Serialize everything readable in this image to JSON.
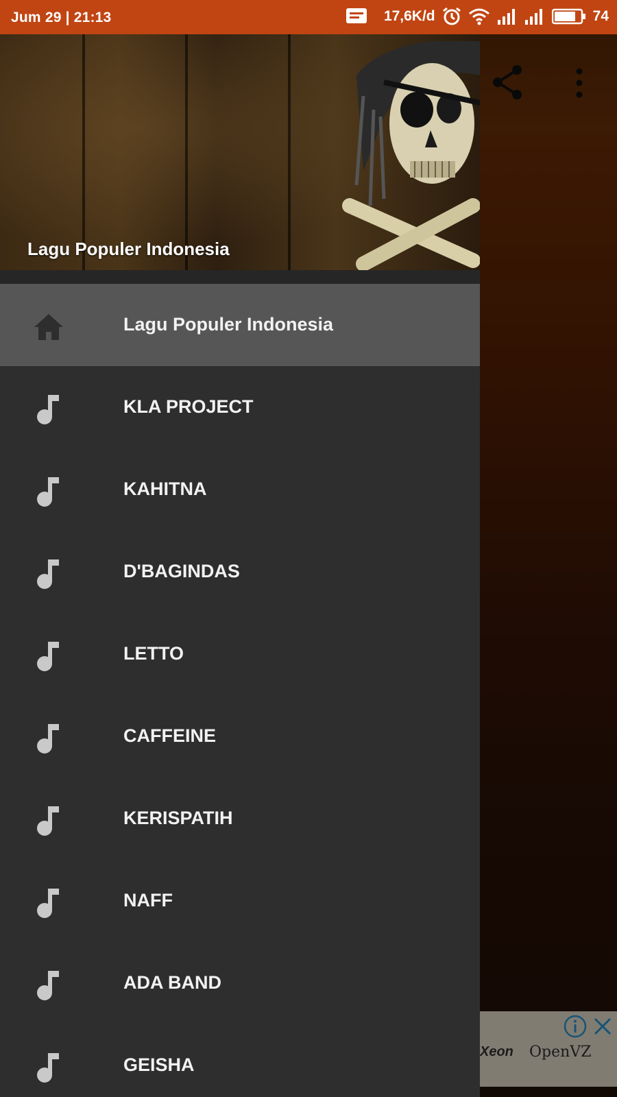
{
  "status_bar": {
    "time": "Jum 29 | 21:13",
    "speed": "17,6K/d",
    "battery": "74",
    "icons": [
      "message-icon",
      "alarm-icon",
      "wifi-icon",
      "signal-icon",
      "signal-icon",
      "battery-icon"
    ]
  },
  "colors": {
    "status_bar": "#c14512",
    "drawer_bg": "#2e2e2e",
    "active_item_bg": "#565656",
    "icon_gray": "#c9c9c9"
  },
  "drawer": {
    "header_title": "Lagu Populer Indonesia",
    "items": [
      {
        "label": "Lagu Populer Indonesia",
        "icon": "home-icon",
        "active": true
      },
      {
        "label": "KLA PROJECT",
        "icon": "music-note-icon"
      },
      {
        "label": "KAHITNA",
        "icon": "music-note-icon"
      },
      {
        "label": "D'BAGINDAS",
        "icon": "music-note-icon"
      },
      {
        "label": "LETTO",
        "icon": "music-note-icon"
      },
      {
        "label": "CAFFEINE",
        "icon": "music-note-icon"
      },
      {
        "label": "KERISPATIH",
        "icon": "music-note-icon"
      },
      {
        "label": "NAFF",
        "icon": "music-note-icon"
      },
      {
        "label": "ADA BAND",
        "icon": "music-note-icon"
      },
      {
        "label": "GEISHA",
        "icon": "music-note-icon"
      }
    ]
  },
  "toolbar": {
    "icons": [
      "share-icon",
      "more-vert-icon"
    ]
  },
  "ad": {
    "text_left": "Xeon",
    "text_right": "OpenVZ"
  }
}
